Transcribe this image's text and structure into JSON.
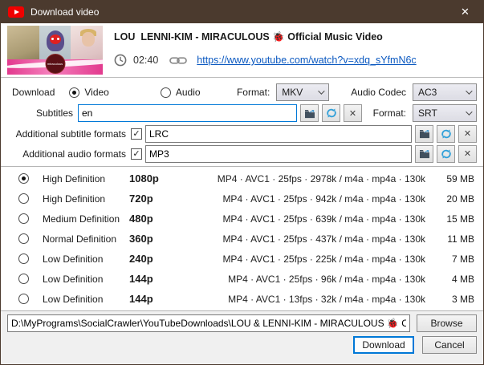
{
  "window": {
    "title": "Download video",
    "close_glyph": "✕"
  },
  "video": {
    "title": "LOU  LENNI-KIM - MIRACULOUS 🐞 Official Music Video",
    "duration": "02:40",
    "url": "https://www.youtube.com/watch?v=xdq_sYfmN6c"
  },
  "controls": {
    "download_label": "Download",
    "video_radio_label": "Video",
    "audio_radio_label": "Audio",
    "format_label": "Format:",
    "format_value": "MKV",
    "audio_codec_label": "Audio Codec",
    "audio_codec_value": "AC3",
    "subtitles_label": "Subtitles",
    "subtitles_value": "en",
    "subtitle_format_label": "Format:",
    "subtitle_format_value": "SRT",
    "additional_subtitle_label": "Additional subtitle formats",
    "additional_subtitle_value": "LRC",
    "additional_audio_label": "Additional audio formats",
    "additional_audio_value": "MP3",
    "clear_glyph": "✕",
    "check_glyph": "✓"
  },
  "qualities": [
    {
      "definition": "High Definition",
      "resolution": "1080p",
      "details": "MP4 · AVC1 · 25fps · 2978k / m4a · mp4a · 130k",
      "size": "59 MB"
    },
    {
      "definition": "High Definition",
      "resolution": "720p",
      "details": "MP4 · AVC1 · 25fps · 942k / m4a · mp4a · 130k",
      "size": "20 MB"
    },
    {
      "definition": "Medium Definition",
      "resolution": "480p",
      "details": "MP4 · AVC1 · 25fps · 639k / m4a · mp4a · 130k",
      "size": "15 MB"
    },
    {
      "definition": "Normal Definition",
      "resolution": "360p",
      "details": "MP4 · AVC1 · 25fps · 437k / m4a · mp4a · 130k",
      "size": "11 MB"
    },
    {
      "definition": "Low Definition",
      "resolution": "240p",
      "details": "MP4 · AVC1 · 25fps · 225k / m4a · mp4a · 130k",
      "size": "7 MB"
    },
    {
      "definition": "Low Definition",
      "resolution": "144p",
      "details": "MP4 · AVC1 · 25fps · 96k / m4a · mp4a · 130k",
      "size": "4 MB"
    },
    {
      "definition": "Low Definition",
      "resolution": "144p",
      "details": "MP4 · AVC1 · 13fps · 32k / m4a · mp4a · 130k",
      "size": "3 MB"
    }
  ],
  "footer": {
    "path": "D:\\MyPrograms\\SocialCrawler\\YouTubeDownloads\\LOU & LENNI-KIM - MIRACULOUS 🐞 Official Musi",
    "browse_label": "Browse",
    "download_label": "Download",
    "cancel_label": "Cancel"
  },
  "colors": {
    "titlebar": "#4b3a2e",
    "accent_blue": "#0078d7",
    "youtube_red": "#f00000",
    "link_blue": "#0a58c0"
  }
}
